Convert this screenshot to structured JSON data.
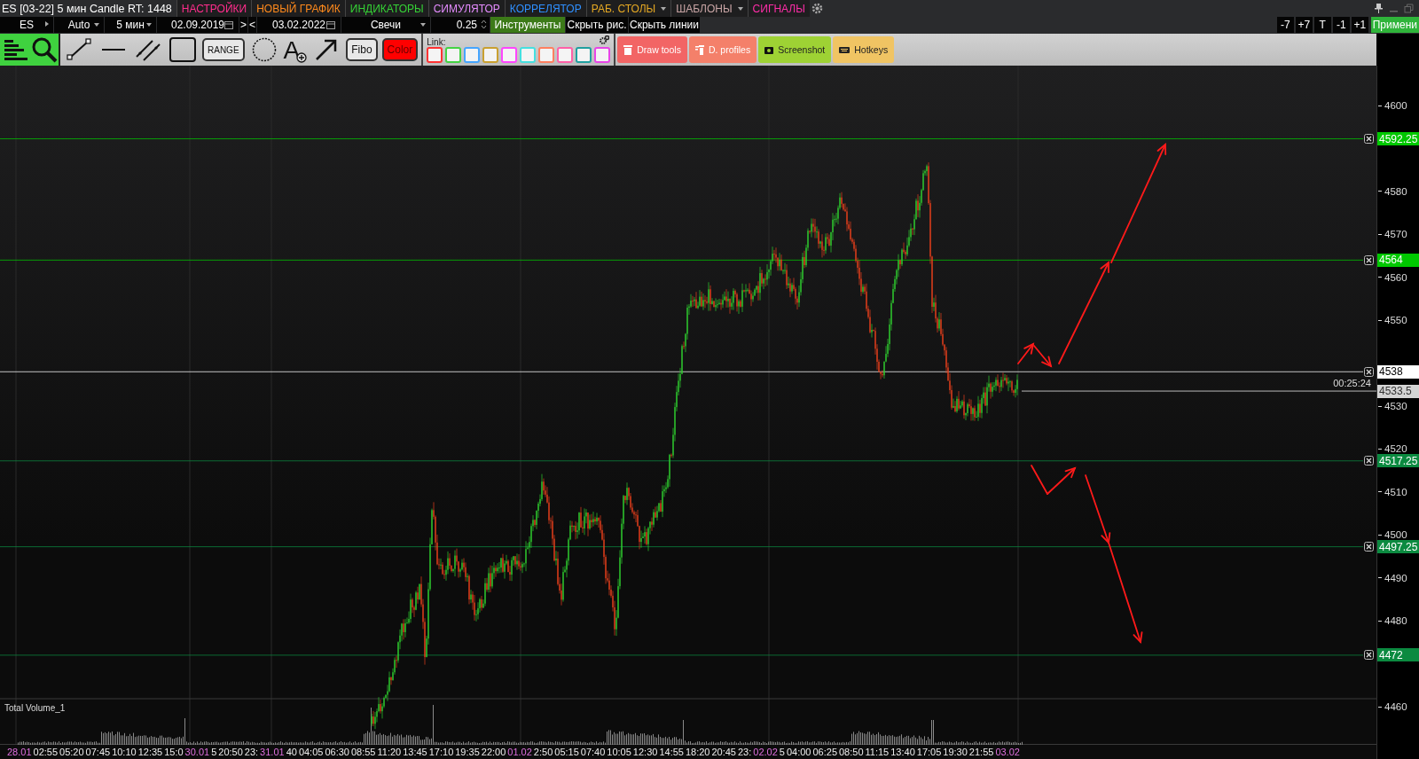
{
  "window": {
    "title": "ES [03-22] 5 мин Candle RT: 1448"
  },
  "menu": [
    {
      "label": "НАСТРОЙКИ",
      "color": "#ff2d8c",
      "dropdown": false
    },
    {
      "label": "НОВЫЙ ГРАФИК",
      "color": "#ff8a1c",
      "dropdown": false
    },
    {
      "label": "ИНДИКАТОРЫ",
      "color": "#35d135",
      "dropdown": false
    },
    {
      "label": "СИМУЛЯТОР",
      "color": "#e58cff",
      "dropdown": false
    },
    {
      "label": "КОРРЕЛЯТОР",
      "color": "#2f8fff",
      "dropdown": false
    },
    {
      "label": "РАБ. СТОЛЫ",
      "color": "#e5a823",
      "dropdown": true
    },
    {
      "label": "ШАБЛОНЫ",
      "color": "#c9a5a5",
      "dropdown": true
    },
    {
      "label": "СИГНАЛЫ",
      "color": "#ff2da8",
      "dropdown": false
    }
  ],
  "inputs": [
    {
      "kind": "symbol",
      "value": "ES"
    },
    {
      "kind": "dropdown",
      "value": "Auto"
    },
    {
      "kind": "dropdown",
      "value": "5 мин"
    },
    {
      "kind": "date",
      "value": "02.09.2019"
    },
    {
      "kind": "step",
      "label": ">"
    },
    {
      "kind": "step",
      "label": "<"
    },
    {
      "kind": "date",
      "value": "03.02.2022"
    },
    {
      "kind": "dropdown",
      "value": "Свечи"
    },
    {
      "kind": "spinner",
      "value": "0.25"
    },
    {
      "kind": "accent",
      "label": "Инструменты"
    },
    {
      "kind": "plain",
      "label": "Скрыть рис."
    },
    {
      "kind": "plain",
      "label": "Скрыть линии"
    }
  ],
  "shift_buttons": [
    "-7",
    "+7",
    "T",
    "-1",
    "+1"
  ],
  "apply_button": "Примени",
  "toolbar": {
    "modes": [
      {
        "kind": "profile"
      },
      {
        "kind": "zoom"
      }
    ],
    "tools": [
      {
        "kind": "segment"
      },
      {
        "kind": "hline"
      },
      {
        "kind": "channel"
      },
      {
        "kind": "rectangle"
      },
      {
        "kind": "range",
        "label": "RANGE"
      },
      {
        "kind": "circle"
      },
      {
        "kind": "text",
        "label": "A"
      },
      {
        "kind": "arrow"
      },
      {
        "kind": "fibo",
        "label": "Fibo"
      },
      {
        "kind": "color",
        "label": "Color"
      }
    ],
    "link": {
      "label": "Link:",
      "slots": [
        {
          "color": "#ff3333"
        },
        {
          "color": "#44d444"
        },
        {
          "color": "#45a5ff"
        },
        {
          "color": "#c9a030"
        },
        {
          "color": "#ff45ff"
        },
        {
          "color": "#45e0e0"
        },
        {
          "color": "#ff8060"
        },
        {
          "color": "#ff60a8"
        },
        {
          "color": "#20a0a0"
        },
        {
          "color": "#e845e8"
        }
      ]
    },
    "actions": [
      {
        "kind": "trash",
        "label": "Draw tools",
        "color": "#f26565"
      },
      {
        "kind": "profiles",
        "label": "D. profiles",
        "color": "#f4806a"
      },
      {
        "kind": "camera",
        "label": "Screenshot",
        "color": "#9ed234"
      },
      {
        "kind": "keyboard",
        "label": "Hotkeys",
        "color": "#f0c463"
      }
    ]
  },
  "price_axis": {
    "ticks": [
      "4600",
      "4580",
      "4570",
      "4560",
      "4550",
      "4530",
      "4520",
      "4510",
      "4500",
      "4490",
      "4480",
      "4460"
    ]
  },
  "levels": [
    {
      "price": "4592.25",
      "color": "#00c800"
    },
    {
      "price": "4564",
      "color": "#00c800"
    },
    {
      "price": "4538",
      "color": "#ffffff"
    },
    {
      "price": "4517.25",
      "color": "#0b8a40"
    },
    {
      "price": "4497.25",
      "color": "#0b8a40"
    },
    {
      "price": "4472",
      "color": "#0b8a40"
    }
  ],
  "current": {
    "price": "4533.5",
    "timer": "00:25:24"
  },
  "volume_panel": {
    "title": "Total Volume_1"
  },
  "time_axis": [
    {
      "label": "28.01",
      "kind": "date"
    },
    {
      "label": "02:55",
      "kind": "time"
    },
    {
      "label": "05:20",
      "kind": "time"
    },
    {
      "label": "07:45",
      "kind": "time"
    },
    {
      "label": "10:10",
      "kind": "time"
    },
    {
      "label": "12:35",
      "kind": "time"
    },
    {
      "label": "15:0",
      "kind": "time"
    },
    {
      "label": "30.01",
      "kind": "date"
    },
    {
      "label": "5",
      "kind": "time"
    },
    {
      "label": "20:50",
      "kind": "time"
    },
    {
      "label": "23:",
      "kind": "time"
    },
    {
      "label": "31.01",
      "kind": "date"
    },
    {
      "label": "40",
      "kind": "time"
    },
    {
      "label": "04:05",
      "kind": "time"
    },
    {
      "label": "06:30",
      "kind": "time"
    },
    {
      "label": "08:55",
      "kind": "time"
    },
    {
      "label": "11:20",
      "kind": "time"
    },
    {
      "label": "13:45",
      "kind": "time"
    },
    {
      "label": "17:10",
      "kind": "time"
    },
    {
      "label": "19:35",
      "kind": "time"
    },
    {
      "label": "22:00",
      "kind": "time"
    },
    {
      "label": "01.02",
      "kind": "date"
    },
    {
      "label": "2:50",
      "kind": "time"
    },
    {
      "label": "05:15",
      "kind": "time"
    },
    {
      "label": "07:40",
      "kind": "time"
    },
    {
      "label": "10:05",
      "kind": "time"
    },
    {
      "label": "12:30",
      "kind": "time"
    },
    {
      "label": "14:55",
      "kind": "time"
    },
    {
      "label": "18:20",
      "kind": "time"
    },
    {
      "label": "20:45",
      "kind": "time"
    },
    {
      "label": "23:",
      "kind": "time"
    },
    {
      "label": "02.02",
      "kind": "date"
    },
    {
      "label": "5",
      "kind": "time"
    },
    {
      "label": "04:00",
      "kind": "time"
    },
    {
      "label": "06:25",
      "kind": "time"
    },
    {
      "label": "08:50",
      "kind": "time"
    },
    {
      "label": "11:15",
      "kind": "time"
    },
    {
      "label": "13:40",
      "kind": "time"
    },
    {
      "label": "17:05",
      "kind": "time"
    },
    {
      "label": "19:30",
      "kind": "time"
    },
    {
      "label": "21:55",
      "kind": "time"
    },
    {
      "label": "03.02",
      "kind": "date"
    }
  ]
}
